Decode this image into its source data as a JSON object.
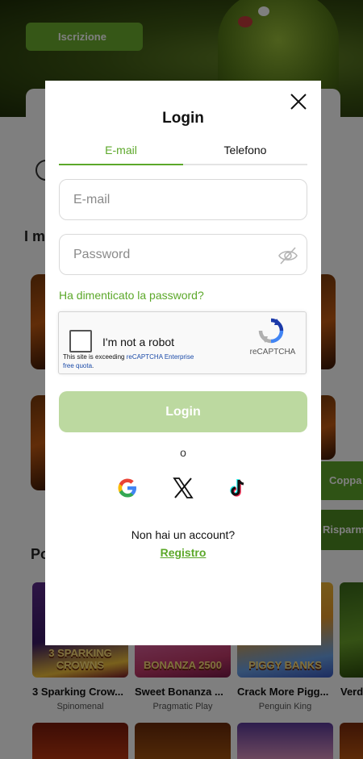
{
  "background": {
    "signup_label": "Iscrizione",
    "section_1_title": "I m",
    "section_2_title": "Po",
    "side_pill_1": "Coppa",
    "side_pill_2": "Risparm",
    "games": [
      {
        "name": "3 Sparking Crow...",
        "provider": "Spinomenal",
        "art_text": "3 SPARKING CROWNS"
      },
      {
        "name": "Sweet Bonanza ...",
        "provider": "Pragmatic Play",
        "art_text": "BONANZA 2500"
      },
      {
        "name": "Crack More Pigg...",
        "provider": "Penguin King",
        "art_text": "PIGGY BANKS"
      },
      {
        "name": "Verd",
        "provider": "",
        "art_text": ""
      }
    ]
  },
  "modal": {
    "title": "Login",
    "tabs": [
      {
        "label": "E-mail",
        "active": true
      },
      {
        "label": "Telefono",
        "active": false
      }
    ],
    "email_placeholder": "E-mail",
    "password_placeholder": "Password",
    "forgot_password": "Ha dimenticato la password?",
    "recaptcha": {
      "label": "I'm not a robot",
      "warning_prefix": "This site is exceeding ",
      "warning_link": "reCAPTCHA Enterprise free quota",
      "warning_suffix": ".",
      "brand": "reCAPTCHA"
    },
    "login_button": "Login",
    "or_separator": "o",
    "social": [
      "google-icon",
      "x-icon",
      "tiktok-icon"
    ],
    "no_account": "Non hai un account?",
    "register_link": "Registro"
  },
  "colors": {
    "accent": "#5ca82a",
    "login_button_disabled": "#bcd9a0"
  }
}
